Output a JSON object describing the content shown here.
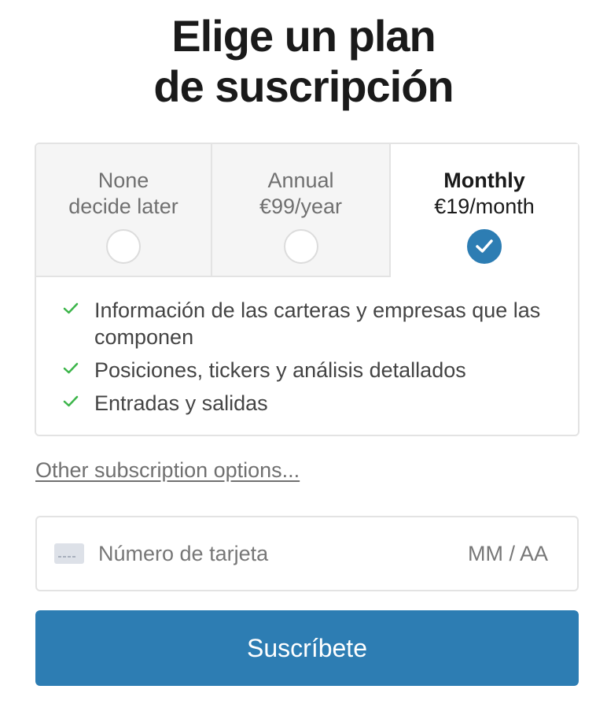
{
  "title": {
    "line1": "Elige un plan",
    "line2": "de suscripción"
  },
  "plans": [
    {
      "name": "None",
      "price": "decide later",
      "selected": false
    },
    {
      "name": "Annual",
      "price": "€99/year",
      "selected": false
    },
    {
      "name": "Monthly",
      "price": "€19/month",
      "selected": true
    }
  ],
  "features": [
    "Información de las carteras y empresas que las componen",
    "Posiciones, tickers y análisis detallados",
    "Entradas y salidas"
  ],
  "other_link": "Other subscription options...",
  "card": {
    "number_placeholder": "Número de tarjeta",
    "expiry_placeholder": "MM / AA"
  },
  "subscribe_label": "Suscríbete",
  "colors": {
    "accent": "#2d7db3",
    "check": "#3cb54a",
    "panel_bg": "#f5f5f5",
    "border": "#e3e3e3"
  },
  "icons": {
    "feature": "checkmark-icon",
    "card": "credit-card-icon",
    "selected": "checkmark-icon"
  }
}
